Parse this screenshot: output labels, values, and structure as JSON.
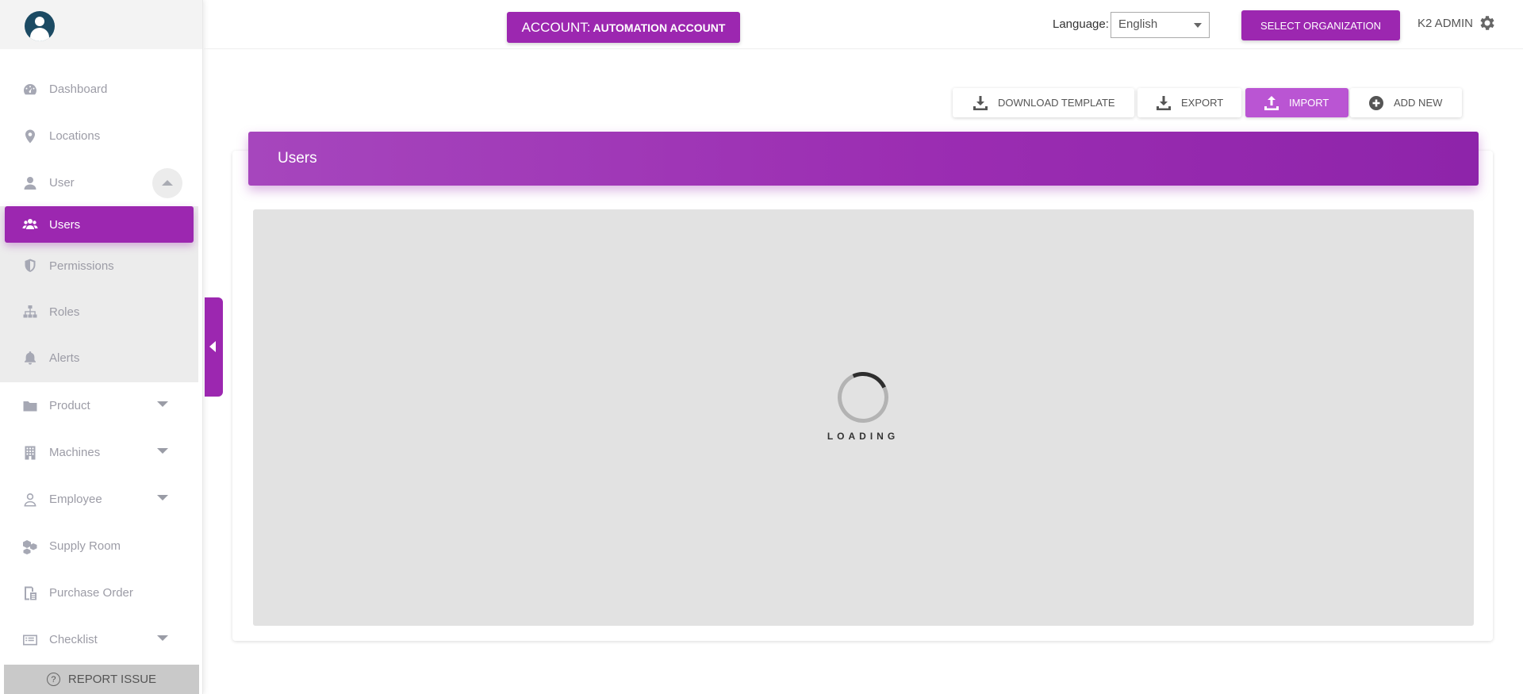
{
  "account": {
    "prefix": "ACCOUNT:",
    "name": "AUTOMATION ACCOUNT"
  },
  "language": {
    "label": "Language:",
    "selected": "English"
  },
  "header": {
    "select_org": "SELECT ORGANIZATION",
    "user_name": "K2 ADMIN"
  },
  "sidebar": {
    "items": [
      {
        "label": "Dashboard",
        "icon": "dashboard-icon"
      },
      {
        "label": "Locations",
        "icon": "location-pin-icon"
      },
      {
        "label": "User",
        "icon": "user-icon"
      },
      {
        "label": "Users",
        "icon": "users-group-icon"
      },
      {
        "label": "Permissions",
        "icon": "shield-icon"
      },
      {
        "label": "Roles",
        "icon": "hierarchy-icon"
      },
      {
        "label": "Alerts",
        "icon": "bell-icon"
      },
      {
        "label": "Product",
        "icon": "folder-icon"
      },
      {
        "label": "Machines",
        "icon": "building-icon"
      },
      {
        "label": "Employee",
        "icon": "person-outline-icon"
      },
      {
        "label": "Supply Room",
        "icon": "boxes-icon"
      },
      {
        "label": "Purchase Order",
        "icon": "clipboard-icon"
      },
      {
        "label": "Checklist",
        "icon": "list-icon"
      }
    ],
    "report_issue": "REPORT ISSUE"
  },
  "actions": {
    "download_template": "DOWNLOAD TEMPLATE",
    "export": "EXPORT",
    "import": "IMPORT",
    "add_new": "ADD NEW"
  },
  "main": {
    "title": "Users",
    "loading": "LOADING"
  },
  "colors": {
    "accent": "#9c27b0",
    "import_button": "#ba55d3"
  }
}
